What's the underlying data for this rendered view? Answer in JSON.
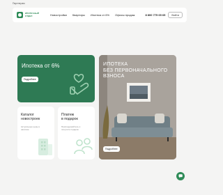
{
  "topbar": {
    "label": "Партнерам"
  },
  "header": {
    "logo_text": [
      "Ипотечный",
      "отдел"
    ],
    "nav": [
      "Новостройки",
      "Квартиры",
      "Ипотека от 6%",
      "Офисы продаж"
    ],
    "phone": "8 800 775 65 65",
    "login": "Войти"
  },
  "promo_main": {
    "title": "Ипотека от 6%",
    "button": "Подробнее"
  },
  "promo_photo": {
    "title_lines": [
      "ИПОТЕКА",
      "БЕЗ ПЕРВОНАЧАЛЬНОГО",
      "ВЗНОСА"
    ],
    "button": "Подробнее"
  },
  "card_catalog": {
    "title_lines": [
      "Каталог",
      "новостроек"
    ],
    "subtitle": "Актуальные цены и наличие"
  },
  "card_gift": {
    "title_lines": [
      "Платеж",
      "в подарок"
    ],
    "subtitle": "Присоединяйтесь и получите подарок"
  },
  "colors": {
    "brand_green": "#2e7a54",
    "accent_green": "#2e8b57",
    "background": "#f4f4f3"
  },
  "icons": [
    "logo-mark-icon",
    "heart-hand-icon",
    "building-icon",
    "people-icon",
    "chat-icon"
  ]
}
